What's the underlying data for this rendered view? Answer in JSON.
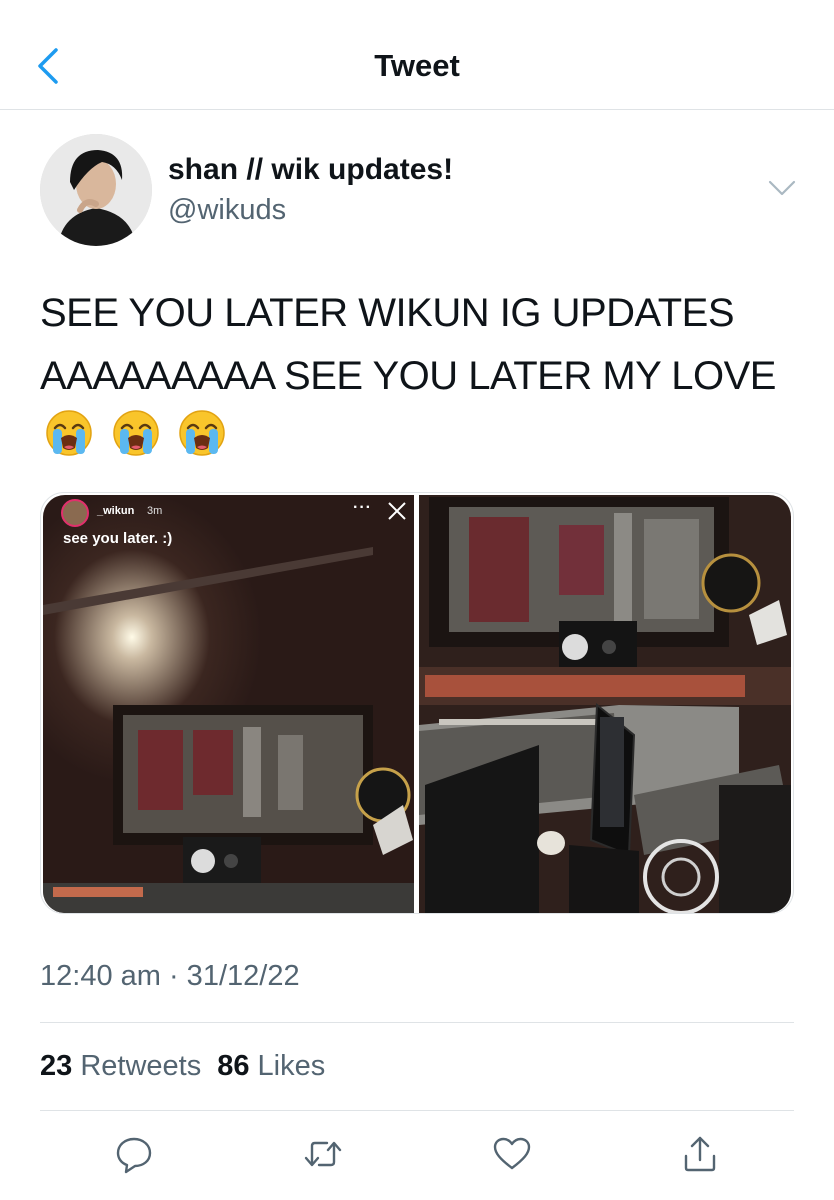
{
  "nav": {
    "title": "Tweet"
  },
  "author": {
    "display_name": "shan // wik updates!",
    "handle": "@wikuds"
  },
  "tweet": {
    "text": "SEE YOU LATER WIKUN IG UPDATES AAAAAAAAA SEE YOU LATER MY LOVE",
    "emojis": [
      "loudly-crying-face",
      "loudly-crying-face",
      "loudly-crying-face"
    ],
    "timestamp": "12:40 am · 31/12/22"
  },
  "media": {
    "story": {
      "username": "_wikun",
      "time": "3m",
      "caption": "see you later. :)",
      "dots": "···"
    }
  },
  "stats": {
    "retweets_count": "23",
    "retweets_label": "Retweets",
    "likes_count": "86",
    "likes_label": "Likes"
  },
  "actions": [
    "reply-icon",
    "retweet-icon",
    "like-icon",
    "share-icon"
  ],
  "colors": {
    "accent": "#1d9bf0",
    "secondary_text": "#536471",
    "divider": "#dfe3e6"
  }
}
